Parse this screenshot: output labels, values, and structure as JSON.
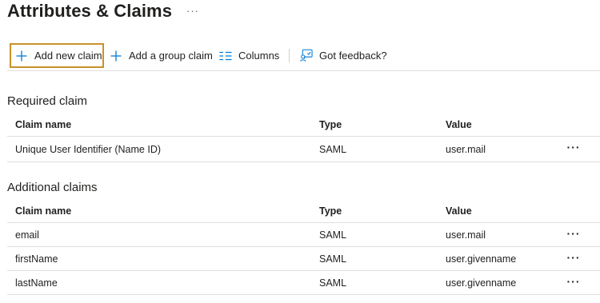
{
  "page": {
    "title": "Attributes & Claims",
    "more_label": "···"
  },
  "toolbar": {
    "add_new_claim": "Add new claim",
    "add_group_claim": "Add a group claim",
    "columns": "Columns",
    "feedback": "Got feedback?"
  },
  "icons": {
    "accent_color": "#0078d4",
    "add": "plus-icon",
    "columns": "columns-icon",
    "feedback": "feedback-icon",
    "more": "ellipsis-icon"
  },
  "highlight_color": "#c8922a",
  "required": {
    "title": "Required claim",
    "headers": {
      "name": "Claim name",
      "type": "Type",
      "value": "Value"
    },
    "rows": [
      {
        "name": "Unique User Identifier (Name ID)",
        "type": "SAML",
        "value": "user.mail",
        "more": "···"
      }
    ]
  },
  "additional": {
    "title": "Additional claims",
    "headers": {
      "name": "Claim name",
      "type": "Type",
      "value": "Value"
    },
    "rows": [
      {
        "name": "email",
        "type": "SAML",
        "value": "user.mail",
        "more": "···"
      },
      {
        "name": "firstName",
        "type": "SAML",
        "value": "user.givenname",
        "more": "···"
      },
      {
        "name": "lastName",
        "type": "SAML",
        "value": "user.givenname",
        "more": "···"
      }
    ]
  }
}
